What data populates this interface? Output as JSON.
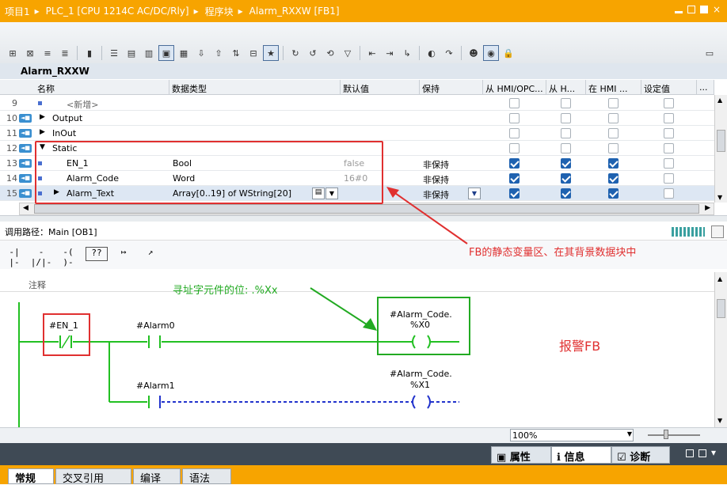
{
  "breadcrumb": {
    "project": "项目1",
    "plc": "PLC_1 [CPU 1214C AC/DC/Rly]",
    "folder": "程序块",
    "block": "Alarm_RXXW [FB1]"
  },
  "block_title": "Alarm_RXXW",
  "interface": {
    "headers": [
      "名称",
      "数据类型",
      "默认值",
      "保持",
      "从 HMI/OPC...",
      "从 H...",
      "在 HMI ...",
      "设定值",
      "..."
    ],
    "rows": [
      {
        "num": "9",
        "name": "<新增>"
      },
      {
        "num": "10",
        "name": "Output"
      },
      {
        "num": "11",
        "name": "InOut"
      },
      {
        "num": "12",
        "name": "Static"
      },
      {
        "num": "13",
        "name": "EN_1",
        "type": "Bool",
        "default": "false",
        "retain": "非保持"
      },
      {
        "num": "14",
        "name": "Alarm_Code",
        "type": "Word",
        "default": "16#0",
        "retain": "非保持"
      },
      {
        "num": "15",
        "name": "Alarm_Text",
        "type": "Array[0..19] of WString[20]",
        "default": "",
        "retain": "非保持"
      }
    ]
  },
  "call_path": "调用路径：Main [OB1]",
  "ladder_toolbar": [
    "-| |-",
    "-|/|-",
    "-( )-",
    "??",
    "↦",
    "↗"
  ],
  "network": {
    "comment_label": "注释",
    "contact1": "#EN_1",
    "contact2": "#Alarm0",
    "contact3": "#Alarm1",
    "coil1_line1": "#Alarm_Code.",
    "coil1_line2": "%X0",
    "coil2_line1": "#Alarm_Code.",
    "coil2_line2": "%X1"
  },
  "annotations": {
    "fb_static": "FB的静态变量区、在其背景数据块中",
    "bit_addr": "寻址字元件的位:   .%Xx",
    "alarm_fb": "报警FB"
  },
  "zoom": "100%",
  "inspector_tabs": [
    "属性",
    "信息",
    "诊断"
  ],
  "bottom_tabs": [
    "常规",
    "交叉引用",
    "编译",
    "语法"
  ],
  "colors": {
    "accent": "#f7a400",
    "annot_red": "#e03030",
    "annot_green": "#22aa22"
  }
}
